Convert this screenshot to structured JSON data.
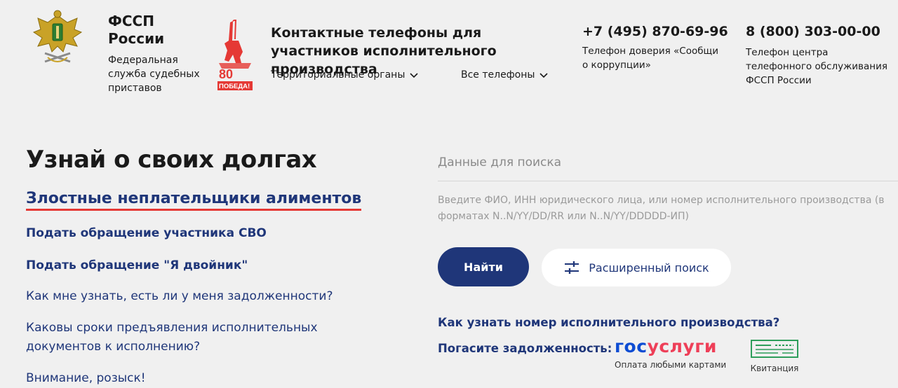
{
  "header": {
    "org_name": "ФССП России",
    "org_description": "Федеральная служба судебных приставов",
    "victory_badge": "80 ПОБЕДА!",
    "contacts_title": "Контактные телефоны для участников исполнительного производства",
    "dropdowns": [
      {
        "label": "Территориальные органы"
      },
      {
        "label": "Все телефоны"
      }
    ],
    "phones": [
      {
        "number": "+7 (495) 870-69-96",
        "description": "Телефон доверия «Сообщи о коррупции»"
      },
      {
        "number": "8 (800) 303-00-00",
        "description": "Телефон центра телефонного обслуживания ФССП России"
      }
    ]
  },
  "main": {
    "title": "Узнай о своих долгах",
    "links": [
      "Злостные неплательщики алиментов",
      "Подать обращение участника СВО",
      "Подать обращение \"Я двойник\"",
      "Как мне узнать, есть ли у меня задолженности?",
      "Каковы сроки предъявления исполнительных документов к исполнению?",
      "Внимание, розыск!"
    ]
  },
  "search": {
    "label": "Данные для поиска",
    "hint": "Введите ФИО, ИНН юридического лица, или номер исполнительного производства (в форматах N..N/YY/DD/RR или N..N/YY/DDDDD-ИП)",
    "find_button": "Найти",
    "advanced_button": "Расширенный поиск",
    "how_link": "Как узнать номер исполнительного производства?",
    "pay_label": "Погасите задолженность:",
    "gosuslugi": {
      "part1": "гос",
      "part2": "услуги",
      "caption": "Оплата любыми картами"
    },
    "receipt_caption": "Квитанция"
  },
  "colors": {
    "accent": "#1f3679",
    "underline": "#e53935",
    "background": "#f0f0f0",
    "gos_blue": "#0d4cd3",
    "gos_red": "#ee3f58"
  }
}
